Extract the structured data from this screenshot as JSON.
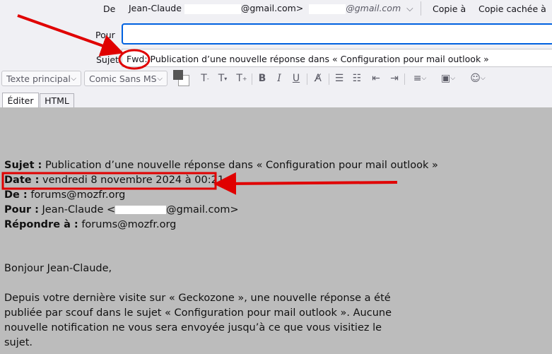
{
  "header": {
    "from_label": "De",
    "from_name": "Jean-Claude",
    "from_email_suffix": "@gmail.com>",
    "from_alt_email_suffix": "@gmail.com",
    "cc_label": "Copie à",
    "bcc_label": "Copie cachée à",
    "to_label": "Pour",
    "to_value": "",
    "subject_label": "Sujet",
    "subject_prefix": "Fwd:",
    "subject_text": "Publication d’une nouvelle réponse dans « Configuration pour mail outlook »"
  },
  "toolbar": {
    "paragraph_format": "Texte principal",
    "font_family": "Comic Sans MS"
  },
  "tabs": [
    {
      "label": "Éditer"
    },
    {
      "label": "HTML"
    }
  ],
  "message": {
    "subject_key": "Sujet :",
    "subject_val": "Publication d’une nouvelle réponse dans « Configuration pour mail outlook »",
    "date_key": "Date :",
    "date_val": "vendredi 8 novembre 2024 à 00:21",
    "from_key": "De :",
    "from_val": "forums@mozfr.org",
    "to_key": "Pour :",
    "to_val_prefix": "Jean-Claude <",
    "to_val_suffix": "@gmail.com>",
    "reply_key": "Répondre à :",
    "reply_val": "forums@mozfr.org",
    "greeting": "Bonjour Jean-Claude,",
    "para1_line1": "Depuis votre dernière visite sur « Geckozone », une nouvelle réponse a été",
    "para1_line2": "publiée par scouf dans le sujet « Configuration pour mail outlook ». Aucune",
    "para1_line3": "nouvelle notification ne vous sera envoyée jusqu’à ce que vous visitiez le",
    "para1_line4": "sujet."
  },
  "colors": {
    "annotation_red": "#e00000",
    "body_bg": "#bcbcbc"
  }
}
